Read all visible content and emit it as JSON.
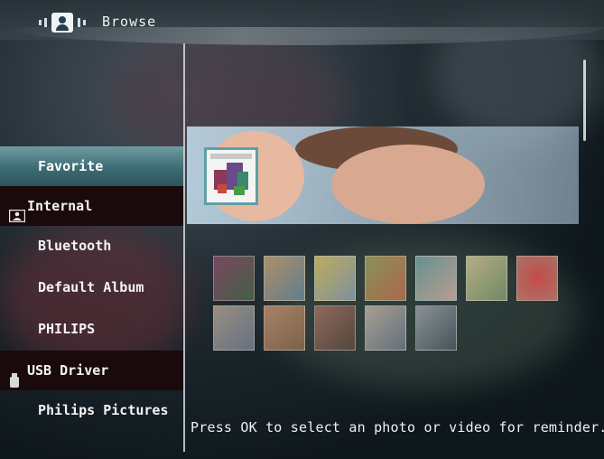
{
  "header": {
    "title": "Browse",
    "icon": "browse-photo-icon"
  },
  "menu": {
    "items": [
      {
        "label": "Favorite",
        "state": "selected"
      },
      {
        "label": "Internal",
        "state": "header",
        "icon": "internal-memory-icon"
      },
      {
        "label": "Bluetooth",
        "state": "normal"
      },
      {
        "label": "Default Album",
        "state": "normal"
      },
      {
        "label": "PHILIPS",
        "state": "normal"
      },
      {
        "label": "USB Driver",
        "state": "header",
        "icon": "usb-icon"
      },
      {
        "label": "Philips Pictures",
        "state": "normal"
      }
    ]
  },
  "thumbnails": {
    "count": 12,
    "selected_index": 0
  },
  "footer": {
    "hint": "Press OK to select an photo or video for reminder."
  },
  "colors": {
    "accent": "#4f8e97",
    "selection_border": "#5e9fa8",
    "text": "#f4f4f4"
  }
}
